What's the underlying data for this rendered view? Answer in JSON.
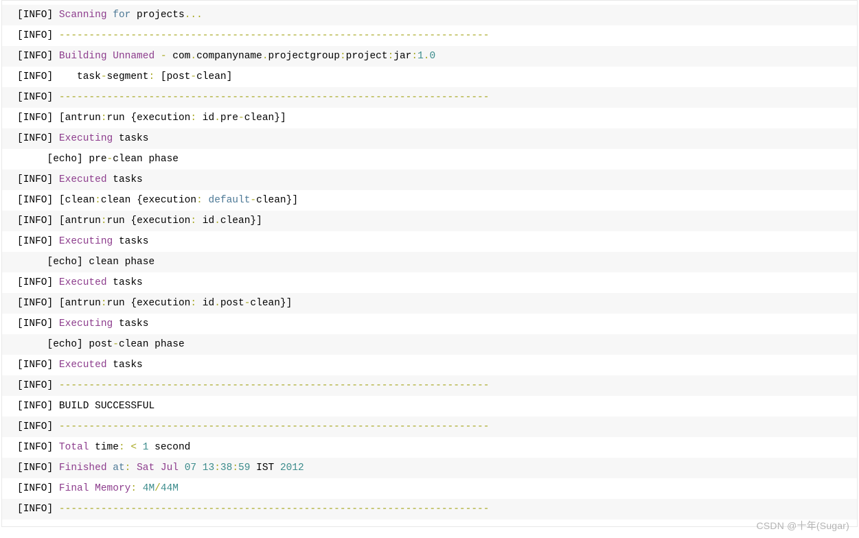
{
  "watermark": "CSDN @十年(Sugar)",
  "lines": [
    [
      [
        "p",
        "["
      ],
      [
        "p",
        "INFO"
      ],
      [
        "p",
        "] "
      ],
      [
        "kw",
        "Scanning"
      ],
      [
        "p",
        " "
      ],
      [
        "fn",
        "for"
      ],
      [
        "p",
        " projects"
      ],
      [
        "op",
        "..."
      ]
    ],
    [
      [
        "p",
        "["
      ],
      [
        "p",
        "INFO"
      ],
      [
        "p",
        "] "
      ],
      [
        "op",
        "------------------------------------------------------------------------"
      ]
    ],
    [
      [
        "p",
        "["
      ],
      [
        "p",
        "INFO"
      ],
      [
        "p",
        "] "
      ],
      [
        "kw",
        "Building"
      ],
      [
        "p",
        " "
      ],
      [
        "kw",
        "Unnamed"
      ],
      [
        "p",
        " "
      ],
      [
        "op",
        "-"
      ],
      [
        "p",
        " com"
      ],
      [
        "op",
        "."
      ],
      [
        "p",
        "companyname"
      ],
      [
        "op",
        "."
      ],
      [
        "p",
        "projectgroup"
      ],
      [
        "op",
        ":"
      ],
      [
        "p",
        "project"
      ],
      [
        "op",
        ":"
      ],
      [
        "p",
        "jar"
      ],
      [
        "op",
        ":"
      ],
      [
        "num",
        "1"
      ],
      [
        "op",
        "."
      ],
      [
        "num",
        "0"
      ]
    ],
    [
      [
        "p",
        "["
      ],
      [
        "p",
        "INFO"
      ],
      [
        "p",
        "]    task"
      ],
      [
        "op",
        "-"
      ],
      [
        "p",
        "segment"
      ],
      [
        "op",
        ":"
      ],
      [
        "p",
        " "
      ],
      [
        "p",
        "["
      ],
      [
        "p",
        "post"
      ],
      [
        "op",
        "-"
      ],
      [
        "p",
        "clean"
      ],
      [
        "p",
        "]"
      ]
    ],
    [
      [
        "p",
        "["
      ],
      [
        "p",
        "INFO"
      ],
      [
        "p",
        "] "
      ],
      [
        "op",
        "------------------------------------------------------------------------"
      ]
    ],
    [
      [
        "p",
        "["
      ],
      [
        "p",
        "INFO"
      ],
      [
        "p",
        "] "
      ],
      [
        "p",
        "["
      ],
      [
        "p",
        "antrun"
      ],
      [
        "op",
        ":"
      ],
      [
        "p",
        "run "
      ],
      [
        "p",
        "{"
      ],
      [
        "p",
        "execution"
      ],
      [
        "op",
        ":"
      ],
      [
        "p",
        " id"
      ],
      [
        "op",
        "."
      ],
      [
        "p",
        "pre"
      ],
      [
        "op",
        "-"
      ],
      [
        "p",
        "clean"
      ],
      [
        "p",
        "}"
      ],
      [
        "p",
        "]"
      ]
    ],
    [
      [
        "p",
        "["
      ],
      [
        "p",
        "INFO"
      ],
      [
        "p",
        "] "
      ],
      [
        "kw",
        "Executing"
      ],
      [
        "p",
        " tasks"
      ]
    ],
    [
      [
        "p",
        "     "
      ],
      [
        "p",
        "["
      ],
      [
        "p",
        "echo"
      ],
      [
        "p",
        "]"
      ],
      [
        "p",
        " pre"
      ],
      [
        "op",
        "-"
      ],
      [
        "p",
        "clean phase"
      ]
    ],
    [
      [
        "p",
        "["
      ],
      [
        "p",
        "INFO"
      ],
      [
        "p",
        "] "
      ],
      [
        "kw",
        "Executed"
      ],
      [
        "p",
        " tasks"
      ]
    ],
    [
      [
        "p",
        "["
      ],
      [
        "p",
        "INFO"
      ],
      [
        "p",
        "] "
      ],
      [
        "p",
        "["
      ],
      [
        "p",
        "clean"
      ],
      [
        "op",
        ":"
      ],
      [
        "p",
        "clean "
      ],
      [
        "p",
        "{"
      ],
      [
        "p",
        "execution"
      ],
      [
        "op",
        ":"
      ],
      [
        "p",
        " "
      ],
      [
        "fn",
        "default"
      ],
      [
        "op",
        "-"
      ],
      [
        "p",
        "clean"
      ],
      [
        "p",
        "}"
      ],
      [
        "p",
        "]"
      ]
    ],
    [
      [
        "p",
        "["
      ],
      [
        "p",
        "INFO"
      ],
      [
        "p",
        "] "
      ],
      [
        "p",
        "["
      ],
      [
        "p",
        "antrun"
      ],
      [
        "op",
        ":"
      ],
      [
        "p",
        "run "
      ],
      [
        "p",
        "{"
      ],
      [
        "p",
        "execution"
      ],
      [
        "op",
        ":"
      ],
      [
        "p",
        " id"
      ],
      [
        "op",
        "."
      ],
      [
        "p",
        "clean"
      ],
      [
        "p",
        "}"
      ],
      [
        "p",
        "]"
      ]
    ],
    [
      [
        "p",
        "["
      ],
      [
        "p",
        "INFO"
      ],
      [
        "p",
        "] "
      ],
      [
        "kw",
        "Executing"
      ],
      [
        "p",
        " tasks"
      ]
    ],
    [
      [
        "p",
        "     "
      ],
      [
        "p",
        "["
      ],
      [
        "p",
        "echo"
      ],
      [
        "p",
        "]"
      ],
      [
        "p",
        " clean phase"
      ]
    ],
    [
      [
        "p",
        "["
      ],
      [
        "p",
        "INFO"
      ],
      [
        "p",
        "] "
      ],
      [
        "kw",
        "Executed"
      ],
      [
        "p",
        " tasks"
      ]
    ],
    [
      [
        "p",
        "["
      ],
      [
        "p",
        "INFO"
      ],
      [
        "p",
        "] "
      ],
      [
        "p",
        "["
      ],
      [
        "p",
        "antrun"
      ],
      [
        "op",
        ":"
      ],
      [
        "p",
        "run "
      ],
      [
        "p",
        "{"
      ],
      [
        "p",
        "execution"
      ],
      [
        "op",
        ":"
      ],
      [
        "p",
        " id"
      ],
      [
        "op",
        "."
      ],
      [
        "p",
        "post"
      ],
      [
        "op",
        "-"
      ],
      [
        "p",
        "clean"
      ],
      [
        "p",
        "}"
      ],
      [
        "p",
        "]"
      ]
    ],
    [
      [
        "p",
        "["
      ],
      [
        "p",
        "INFO"
      ],
      [
        "p",
        "] "
      ],
      [
        "kw",
        "Executing"
      ],
      [
        "p",
        " tasks"
      ]
    ],
    [
      [
        "p",
        "     "
      ],
      [
        "p",
        "["
      ],
      [
        "p",
        "echo"
      ],
      [
        "p",
        "]"
      ],
      [
        "p",
        " post"
      ],
      [
        "op",
        "-"
      ],
      [
        "p",
        "clean phase"
      ]
    ],
    [
      [
        "p",
        "["
      ],
      [
        "p",
        "INFO"
      ],
      [
        "p",
        "] "
      ],
      [
        "kw",
        "Executed"
      ],
      [
        "p",
        " tasks"
      ]
    ],
    [
      [
        "p",
        "["
      ],
      [
        "p",
        "INFO"
      ],
      [
        "p",
        "] "
      ],
      [
        "op",
        "------------------------------------------------------------------------"
      ]
    ],
    [
      [
        "p",
        "["
      ],
      [
        "p",
        "INFO"
      ],
      [
        "p",
        "] BUILD SUCCESSFUL"
      ]
    ],
    [
      [
        "p",
        "["
      ],
      [
        "p",
        "INFO"
      ],
      [
        "p",
        "] "
      ],
      [
        "op",
        "------------------------------------------------------------------------"
      ]
    ],
    [
      [
        "p",
        "["
      ],
      [
        "p",
        "INFO"
      ],
      [
        "p",
        "] "
      ],
      [
        "kw",
        "Total"
      ],
      [
        "p",
        " time"
      ],
      [
        "op",
        ":"
      ],
      [
        "p",
        " "
      ],
      [
        "op",
        "<"
      ],
      [
        "p",
        " "
      ],
      [
        "num",
        "1"
      ],
      [
        "p",
        " second"
      ]
    ],
    [
      [
        "p",
        "["
      ],
      [
        "p",
        "INFO"
      ],
      [
        "p",
        "] "
      ],
      [
        "kw",
        "Finished"
      ],
      [
        "p",
        " "
      ],
      [
        "fn",
        "at"
      ],
      [
        "op",
        ":"
      ],
      [
        "p",
        " "
      ],
      [
        "kw",
        "Sat"
      ],
      [
        "p",
        " "
      ],
      [
        "kw",
        "Jul"
      ],
      [
        "p",
        " "
      ],
      [
        "num",
        "07"
      ],
      [
        "p",
        " "
      ],
      [
        "num",
        "13"
      ],
      [
        "op",
        ":"
      ],
      [
        "num",
        "38"
      ],
      [
        "op",
        ":"
      ],
      [
        "num",
        "59"
      ],
      [
        "p",
        " IST "
      ],
      [
        "num",
        "2012"
      ]
    ],
    [
      [
        "p",
        "["
      ],
      [
        "p",
        "INFO"
      ],
      [
        "p",
        "] "
      ],
      [
        "kw",
        "Final"
      ],
      [
        "p",
        " "
      ],
      [
        "kw",
        "Memory"
      ],
      [
        "op",
        ":"
      ],
      [
        "p",
        " "
      ],
      [
        "num",
        "4M"
      ],
      [
        "op",
        "/"
      ],
      [
        "num",
        "44M"
      ]
    ],
    [
      [
        "p",
        "["
      ],
      [
        "p",
        "INFO"
      ],
      [
        "p",
        "] "
      ],
      [
        "op",
        "------------------------------------------------------------------------"
      ]
    ]
  ]
}
